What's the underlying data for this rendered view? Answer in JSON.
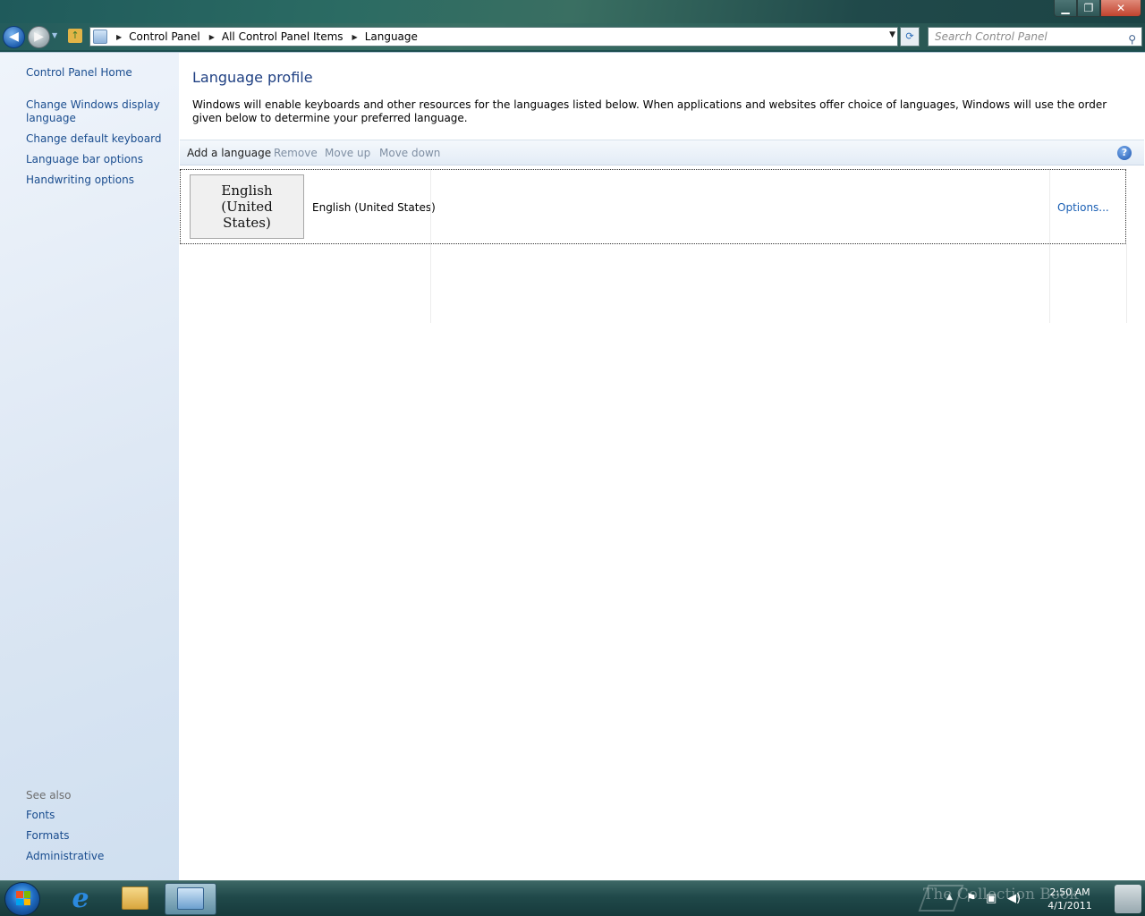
{
  "window": {
    "minimize_glyph": "▁",
    "maximize_glyph": "❐",
    "close_glyph": "✕"
  },
  "address_bar": {
    "breadcrumbs": [
      "Control Panel",
      "All Control Panel Items",
      "Language"
    ],
    "search_placeholder": "Search Control Panel"
  },
  "sidebar": {
    "home": "Control Panel Home",
    "links": [
      "Change Windows display language",
      "Change default keyboard",
      "Language bar options",
      "Handwriting options"
    ],
    "see_also_heading": "See also",
    "see_also": [
      "Fonts",
      "Formats",
      "Administrative"
    ]
  },
  "main": {
    "title": "Language profile",
    "description": "Windows will enable keyboards and other resources for the languages listed below. When applications and websites offer choice of languages, Windows will use the order given below to determine your preferred language.",
    "toolbar": {
      "add": "Add a language",
      "remove": "Remove",
      "move_up": "Move up",
      "move_down": "Move down",
      "help": "?"
    },
    "languages": [
      {
        "tile": "English (United States)",
        "name": "English (United States)",
        "options": "Options..."
      }
    ]
  },
  "taskbar": {
    "ie_glyph": "e",
    "clock_time": "2:50 AM",
    "clock_date": "4/1/2011",
    "watermark": "The Collection Book"
  },
  "colors": {
    "link": "#1a4d8f",
    "title": "#1e3f82",
    "disabled": "#7f8fa3"
  }
}
